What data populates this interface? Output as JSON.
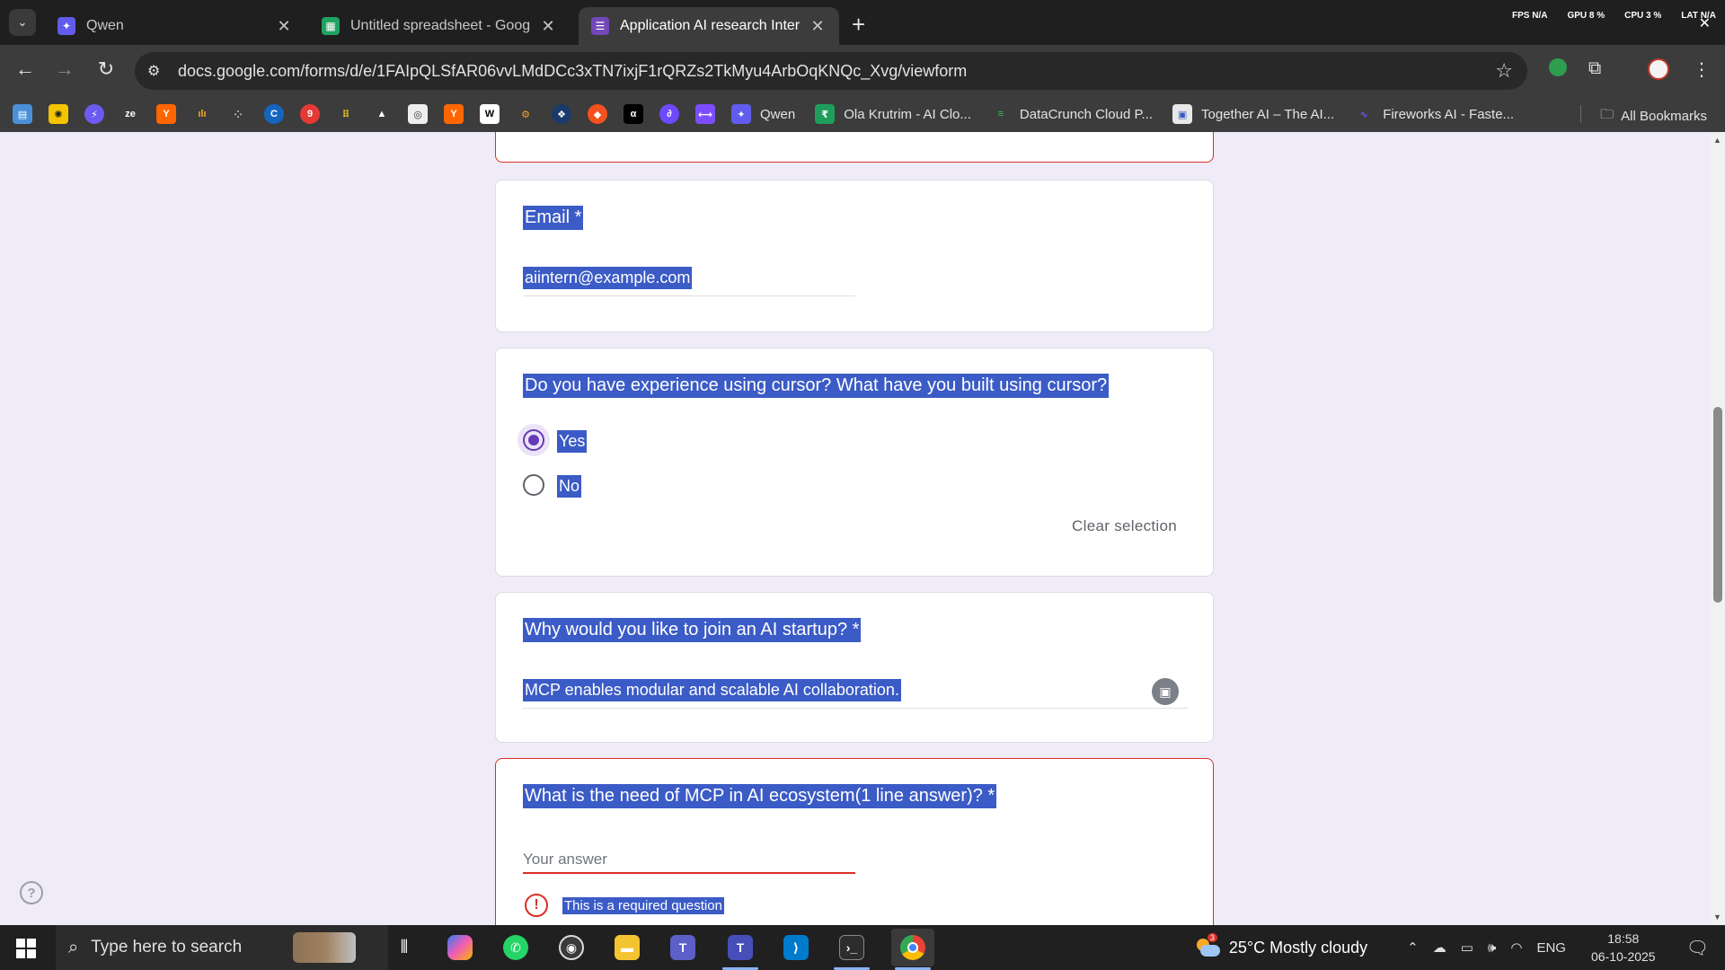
{
  "browser": {
    "tabs": [
      {
        "label": "Qwen",
        "icon": "qwen-icon",
        "color": "#615ced"
      },
      {
        "label": "Untitled spreadsheet - Google S",
        "icon": "sheets-icon",
        "color": "#1ea362"
      },
      {
        "label": "Application AI research Intern",
        "icon": "forms-icon",
        "color": "#7248b9",
        "active": true
      }
    ],
    "perf": {
      "fps_label": "FPS",
      "fps": "N/A",
      "gpu_label": "GPU",
      "gpu": "8 %",
      "cpu_label": "CPU",
      "cpu": "3 %",
      "lat_label": "LAT",
      "lat": "N/A"
    },
    "url": "docs.google.com/forms/d/e/1FAIpQLSfAR06vvLMdDCc3xTN7ixjF1rQRZs2TkMyu4ArbOqKNQc_Xvg/viewform",
    "bookmarks": [
      {
        "label": "Qwen",
        "icon": "qwen-icon",
        "color": "#615ced"
      },
      {
        "label": "Ola Krutrim - AI Clo...",
        "icon": "krutrim-icon",
        "color": "#1e9e5a"
      },
      {
        "label": "DataCrunch Cloud P...",
        "icon": "datacrunch-icon",
        "color": "#2f8f3a"
      },
      {
        "label": "Together AI – The AI...",
        "icon": "together-icon",
        "color": "#e8e8e8"
      },
      {
        "label": "Fireworks AI - Faste...",
        "icon": "fireworks-icon",
        "color": "#6b3fd4"
      }
    ],
    "all_bookmarks": "All Bookmarks"
  },
  "form": {
    "email": {
      "label": "Email *",
      "value": "aiintern@example.com"
    },
    "cursor_question": {
      "label": "Do you have experience using cursor? What have you built using cursor?",
      "options": [
        "Yes",
        "No"
      ],
      "selected": "Yes",
      "clear": "Clear selection"
    },
    "startup_question": {
      "label": "Why would you like to join an AI startup? *",
      "value": "MCP enables modular and scalable AI collaboration."
    },
    "mcp_question": {
      "label": "What is the need of MCP in AI ecosystem(1 line answer)? *",
      "placeholder": "Your answer",
      "error": "This is a required question"
    }
  },
  "taskbar": {
    "search_placeholder": "Type here to search",
    "weather_temp": "25°C",
    "weather_desc": "Mostly cloudy",
    "weather_badge": "3",
    "language": "ENG",
    "time": "18:58",
    "date": "06-10-2025"
  }
}
